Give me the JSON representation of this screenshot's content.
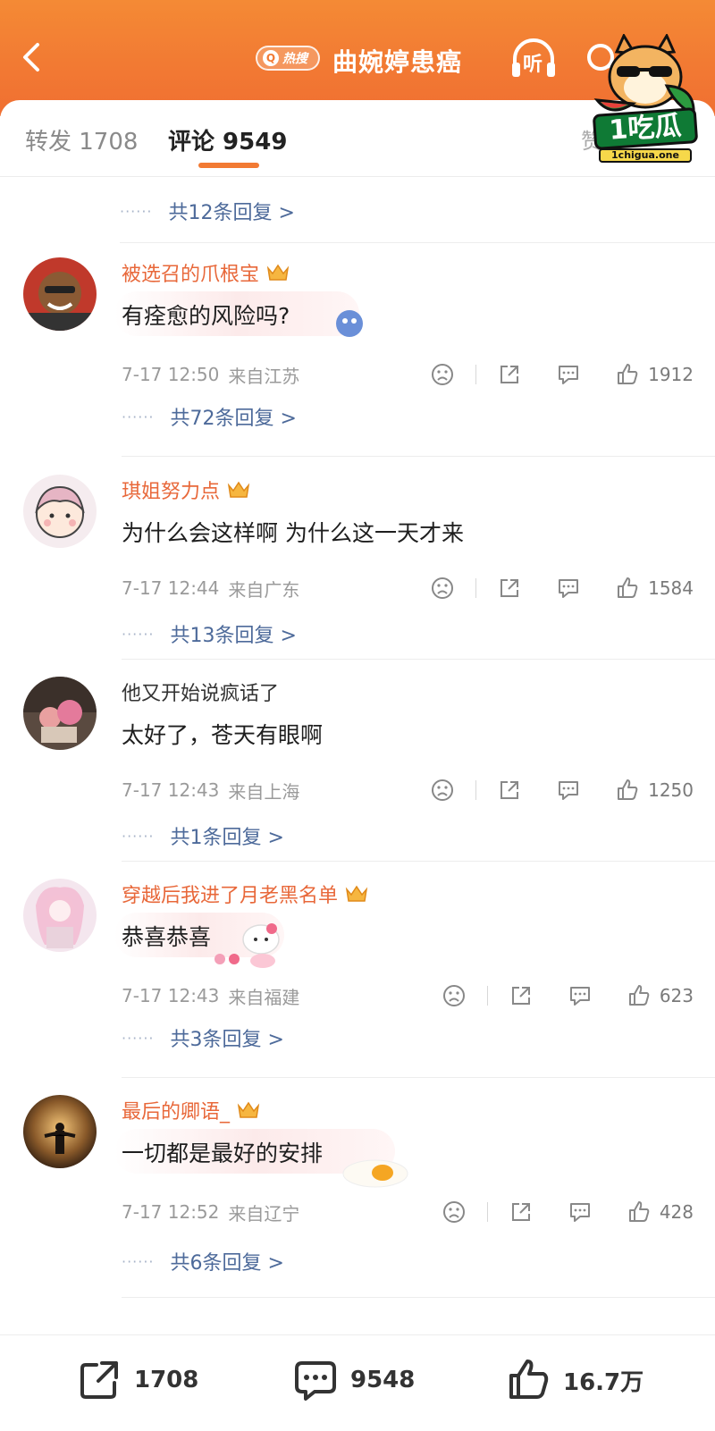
{
  "header": {
    "hot_label": "热搜",
    "topic_title": "曲婉婷患癌",
    "listen_label": "听"
  },
  "watermark": {
    "brand": "1吃瓜",
    "url": "1chigua.one"
  },
  "tabs": {
    "repost": "转发 1708",
    "comment": "评论 9549",
    "extra": "赞"
  },
  "first_reply": "共12条回复 >",
  "comments": [
    {
      "name": "被选召的爪根宝",
      "text": "有痊愈的风险吗?",
      "time": "7-17 12:50",
      "location": "来自江苏",
      "likes": "1912",
      "replies": "共72条回复 >"
    },
    {
      "name": "琪姐努力点",
      "text": "为什么会这样啊  为什么这一天才来",
      "time": "7-17 12:44",
      "location": "来自广东",
      "likes": "1584",
      "replies": "共13条回复 >"
    },
    {
      "name": "他又开始说疯话了",
      "text": "太好了，苍天有眼啊",
      "time": "7-17 12:43",
      "location": "来自上海",
      "likes": "1250",
      "replies": "共1条回复 >"
    },
    {
      "name": "穿越后我进了月老黑名单",
      "text": "恭喜恭喜",
      "time": "7-17 12:43",
      "location": "来自福建",
      "likes": "623",
      "replies": "共3条回复 >"
    },
    {
      "name": "最后的卿语_",
      "text": "一切都是最好的安排",
      "time": "7-17 12:52",
      "location": "来自辽宁",
      "likes": "428",
      "replies": "共6条回复 >"
    }
  ],
  "bottom_bar": {
    "repost_count": "1708",
    "comment_count": "9548",
    "like_count": "16.7万"
  },
  "colors": {
    "header_orange": "#f27a33",
    "username_orange": "#e8683a",
    "reply_link_blue": "#4d6a9a"
  }
}
